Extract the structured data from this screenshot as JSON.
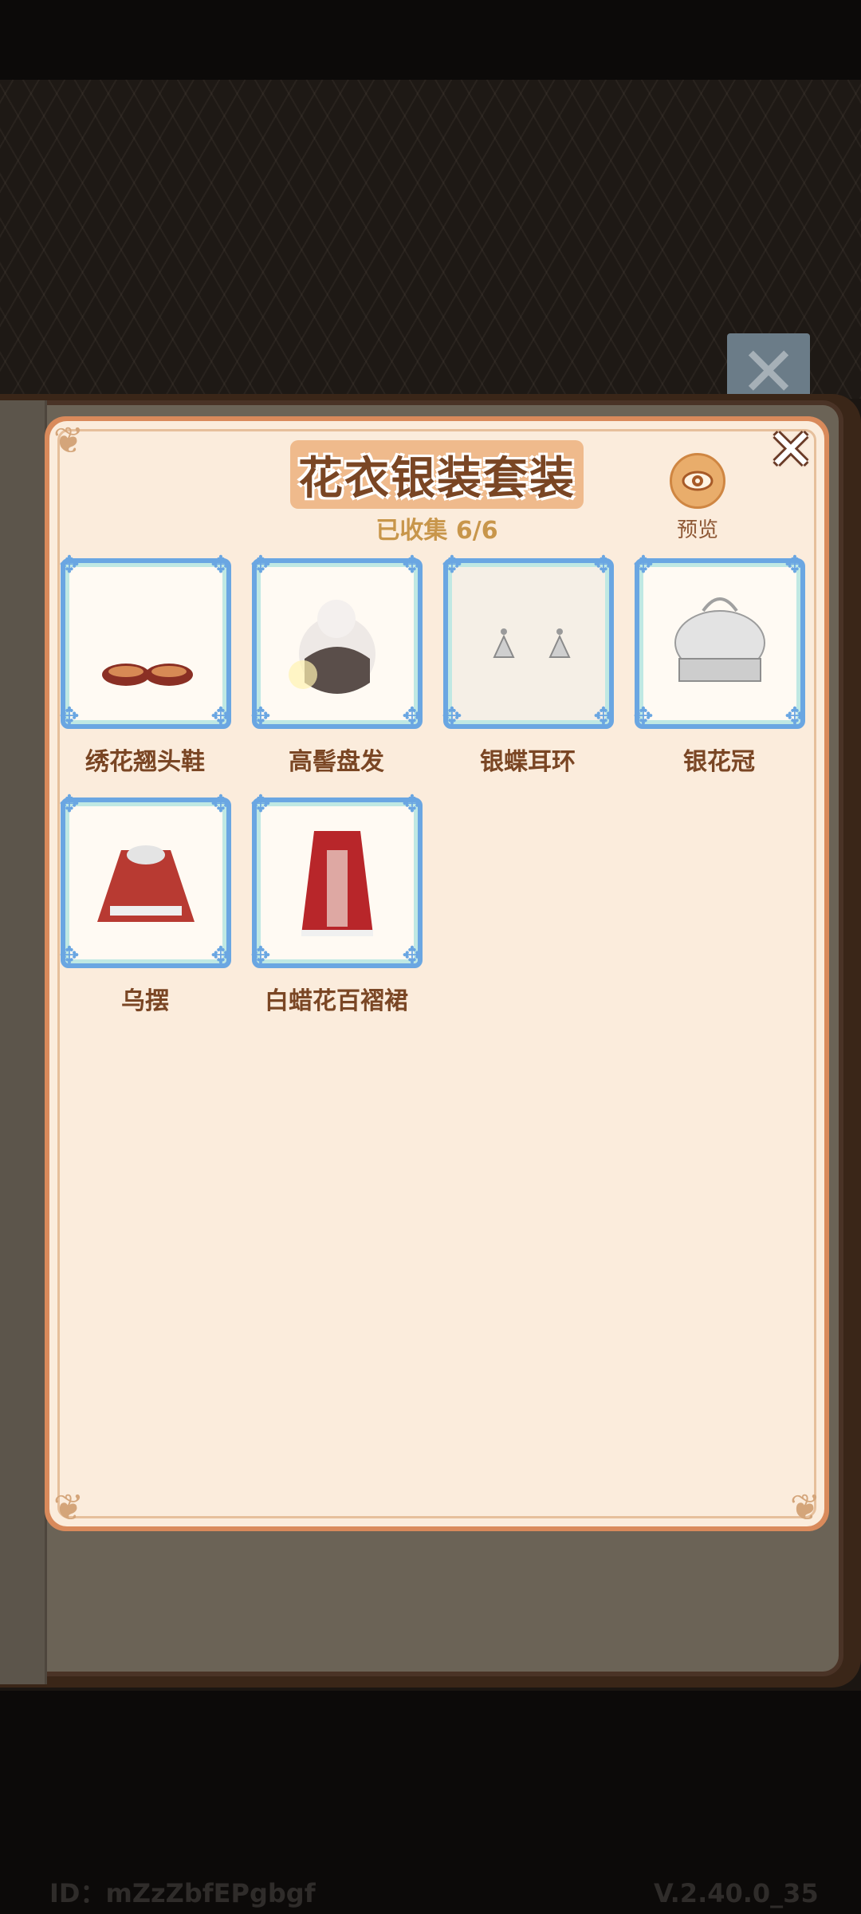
{
  "dialog": {
    "title": "花衣银装套装",
    "progress": "已收集 6/6",
    "preview_label": "预览",
    "close_icon": "close-icon",
    "preview_icon": "eye-icon"
  },
  "items": [
    {
      "name": "绣花翘头鞋",
      "icon": "shoes-icon"
    },
    {
      "name": "高髻盘发",
      "icon": "hairstyle-icon"
    },
    {
      "name": "银蝶耳环",
      "icon": "earrings-icon"
    },
    {
      "name": "银花冠",
      "icon": "silver-crown-icon"
    },
    {
      "name": "乌摆",
      "icon": "top-garment-icon"
    },
    {
      "name": "白蜡花百褶裙",
      "icon": "pleated-skirt-icon"
    }
  ],
  "footer": {
    "id": "ID：mZzZbfEPgbgf",
    "version": "V.2.40.0_35"
  },
  "colors": {
    "panel_bg": "#fbecdc",
    "card_border": "#6aa6e2",
    "title_text": "#7a4624",
    "progress_text": "#c8964b"
  }
}
